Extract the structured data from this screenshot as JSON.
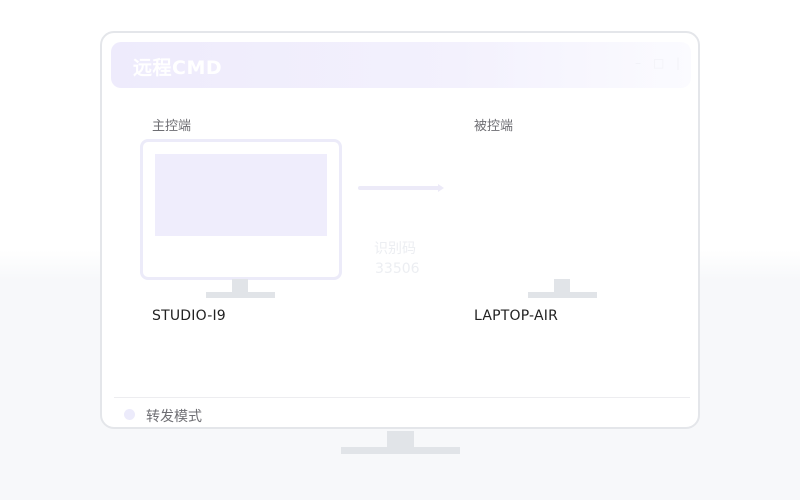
{
  "window": {
    "title": "远程CMD",
    "controls": [
      {
        "name": "minimize-icon",
        "glyph": "–"
      },
      {
        "name": "maximize-icon",
        "glyph": "□"
      },
      {
        "name": "close-icon",
        "glyph": "|"
      }
    ]
  },
  "controller": {
    "label": "主控端",
    "device_name": "STUDIO-I9"
  },
  "controlled": {
    "label": "被控端",
    "device_name": "LAPTOP-AIR"
  },
  "connection": {
    "code_label": "识别码",
    "code_value": "33506"
  },
  "footer": {
    "mode_label": "转发模式"
  },
  "colors": {
    "accent": "#efedfc",
    "frame": "#e4e6ea",
    "stand": "#e1e4e8"
  }
}
